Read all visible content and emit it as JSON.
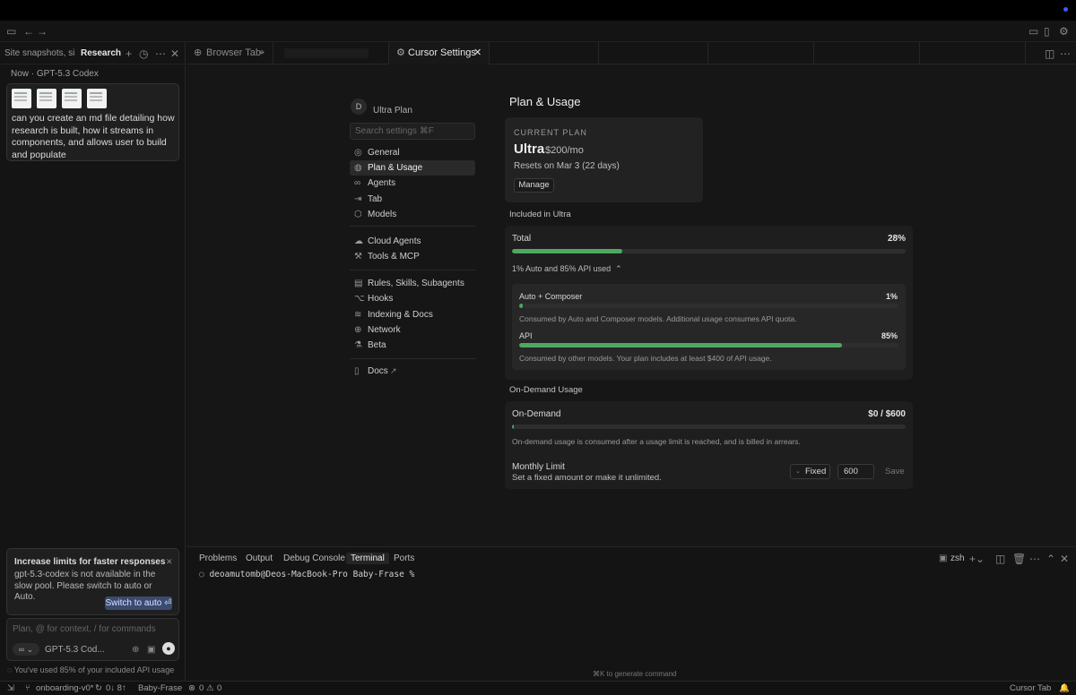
{
  "window": {
    "accent": "#3b5bff"
  },
  "left_panel": {
    "tabs": [
      "Site snapshots, sit",
      "Research fe"
    ],
    "meta": "Now · GPT-5.3 Codex",
    "prompt": "can you create an md file detailing how research is built, how it streams in components, and allows user to build and populate",
    "limit_title": "Increase limits for faster responses",
    "limit_body": "gpt-5.3-codex is not available in the slow pool. Please switch to auto or Auto.",
    "switch_button": "Switch to auto ⏎",
    "input_placeholder": "Plan, @ for context, / for commands",
    "model_name": "GPT-5.3 Cod...",
    "usage_note": "You've used 85% of your included API usage"
  },
  "editor_tabs": {
    "browser": "Browser Tab",
    "settings": "Cursor Settings"
  },
  "settings_nav": {
    "avatar": "D",
    "plan": "Ultra Plan",
    "search_placeholder": "Search settings ⌘F",
    "items": [
      {
        "icon": "gear-icon",
        "glyph": "◎",
        "label": "General"
      },
      {
        "icon": "plan-icon",
        "glyph": "◍",
        "label": "Plan & Usage"
      },
      {
        "icon": "infinity-icon",
        "glyph": "∞",
        "label": "Agents"
      },
      {
        "icon": "tab-arrow-icon",
        "glyph": "⇥",
        "label": "Tab"
      },
      {
        "icon": "cube-icon",
        "glyph": "⬡",
        "label": "Models"
      },
      {
        "icon": "cloud-icon",
        "glyph": "☁",
        "label": "Cloud Agents"
      },
      {
        "icon": "tools-icon",
        "glyph": "⚒",
        "label": "Tools & MCP"
      },
      {
        "icon": "clipboard-icon",
        "glyph": "▤",
        "label": "Rules, Skills, Subagents"
      },
      {
        "icon": "hook-icon",
        "glyph": "⌥",
        "label": "Hooks"
      },
      {
        "icon": "database-icon",
        "glyph": "≋",
        "label": "Indexing & Docs"
      },
      {
        "icon": "globe-icon",
        "glyph": "⊕",
        "label": "Network"
      },
      {
        "icon": "flask-icon",
        "glyph": "⚗",
        "label": "Beta"
      },
      {
        "icon": "book-icon",
        "glyph": "📖",
        "label": "Docs"
      }
    ]
  },
  "plan": {
    "heading": "Plan & Usage",
    "current_label": "CURRENT PLAN",
    "name": "Ultra",
    "price": "$200/mo",
    "resets": "Resets on Mar 3 (22 days)",
    "manage": "Manage"
  },
  "included": {
    "label": "Included in Ultra",
    "total_label": "Total",
    "total_pct": "28%",
    "total_fill": 0.28,
    "breakdown": "1% Auto and 85% API used",
    "auto_label": "Auto + Composer",
    "auto_pct": "1%",
    "auto_fill": 0.01,
    "auto_desc": "Consumed by Auto and Composer models. Additional usage consumes API quota.",
    "api_label": "API",
    "api_pct": "85%",
    "api_fill": 0.85,
    "api_desc": "Consumed by other models. Your plan includes at least $400 of API usage."
  },
  "on_demand": {
    "section": "On-Demand Usage",
    "label": "On-Demand",
    "amount": "$0 / $600",
    "fill": 0.0,
    "desc": "On-demand usage is consumed after a usage limit is reached, and is billed in arrears.",
    "monthly_limit": "Monthly Limit",
    "monthly_desc": "Set a fixed amount or make it unlimited.",
    "mode": "Fixed",
    "value": "600",
    "save": "Save"
  },
  "terminal": {
    "tabs": [
      "Problems",
      "Output",
      "Debug Console",
      "Terminal",
      "Ports"
    ],
    "shell": "zsh",
    "prompt": "deoamutomb@Deos-MacBook-Pro Baby-Frase %",
    "hint": "⌘K to generate command"
  },
  "status": {
    "branch": "onboarding-v0*",
    "sync": "0↓ 8↑",
    "project": "Baby-Frase",
    "errors": "0",
    "warnings": "0",
    "cursor_tab": "Cursor Tab"
  }
}
